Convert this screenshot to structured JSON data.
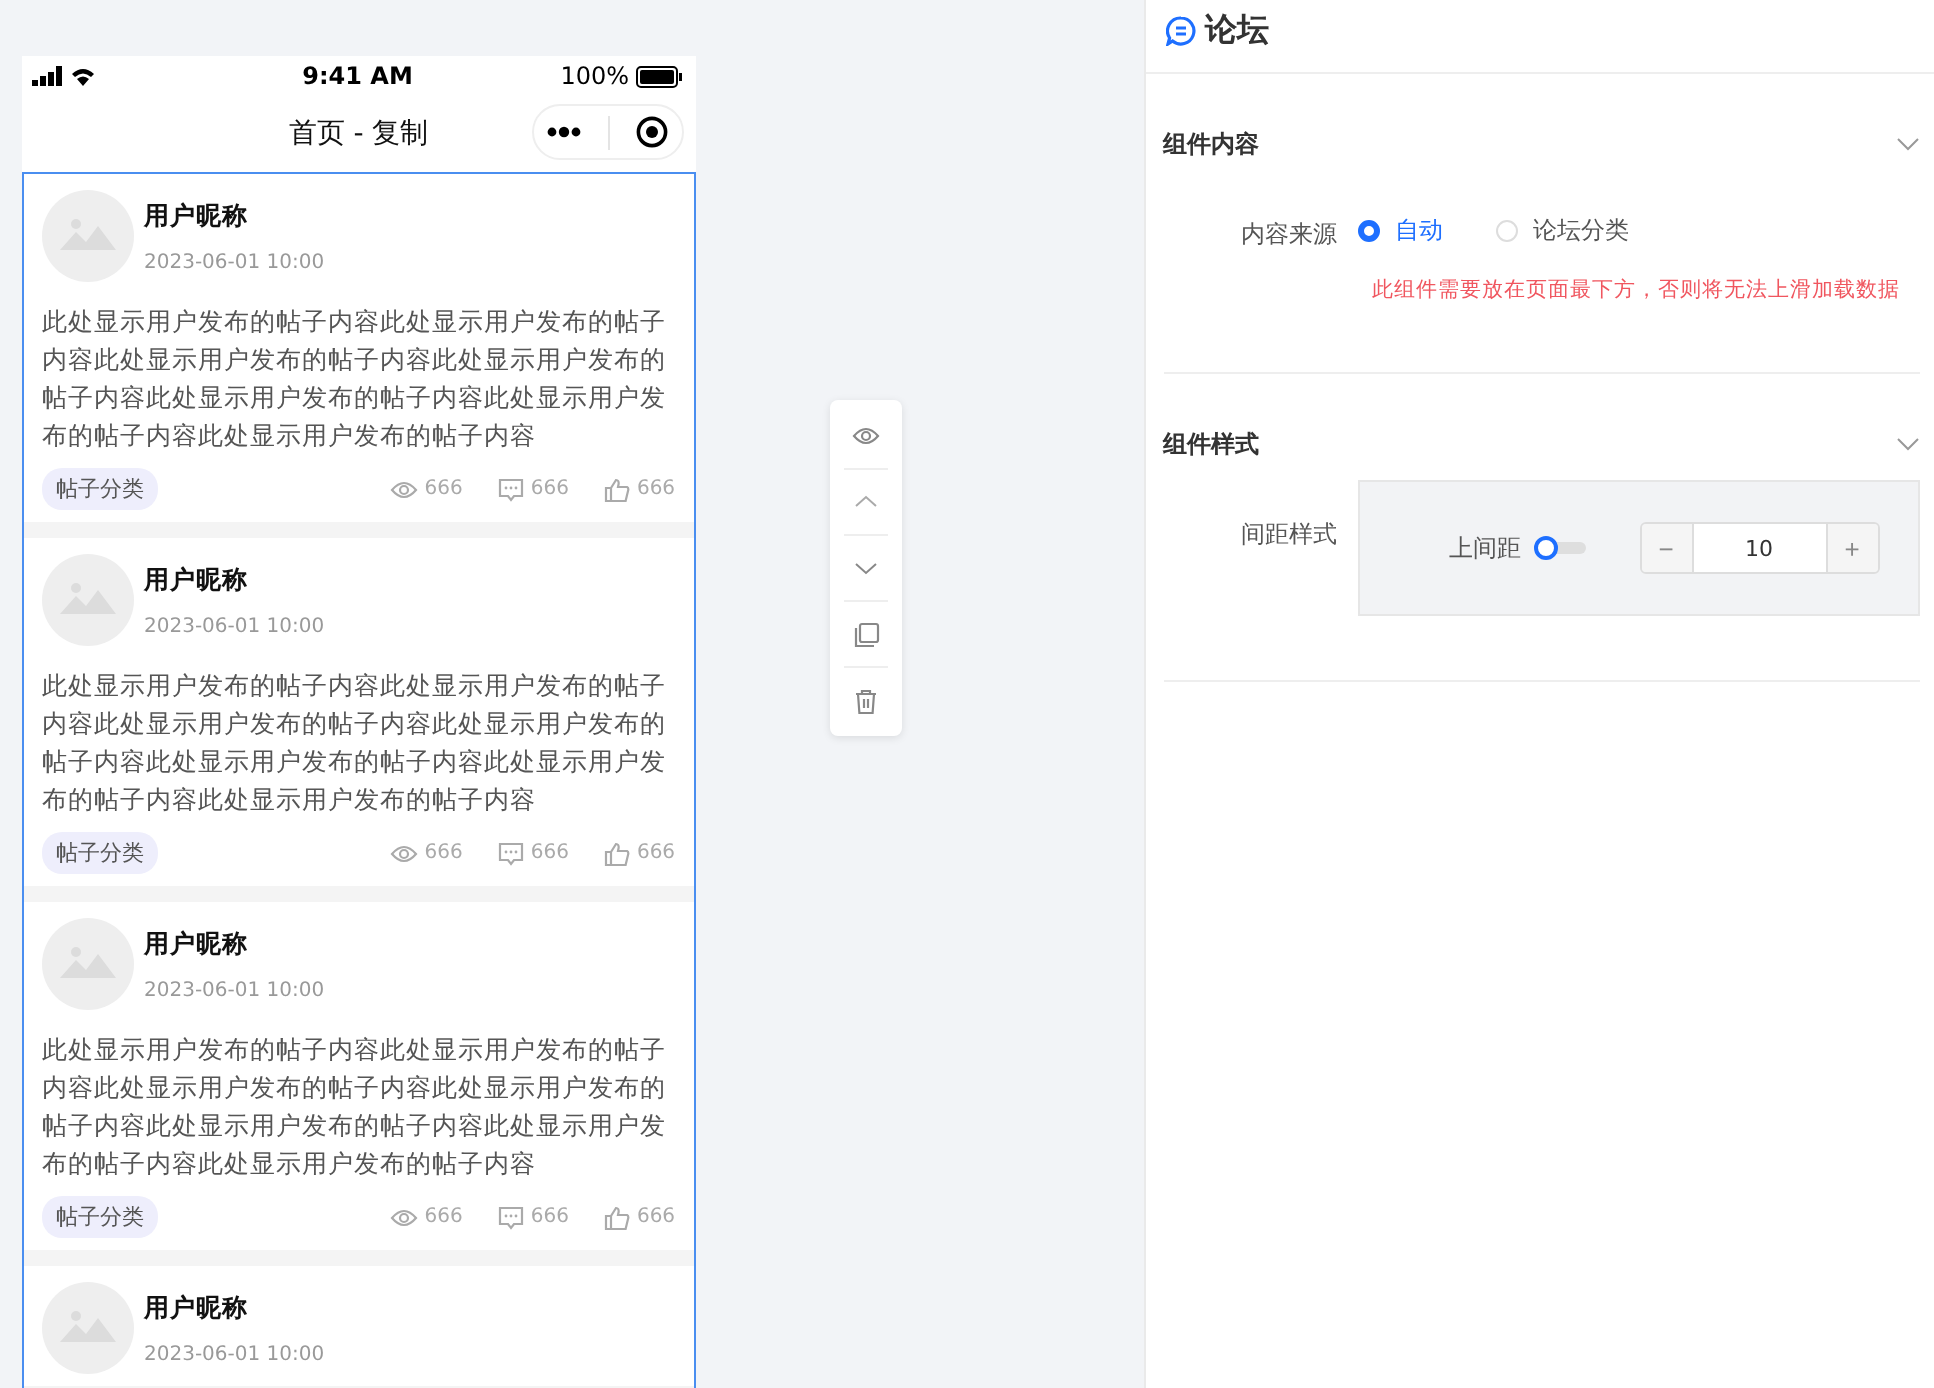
{
  "phone": {
    "status_bar": {
      "time": "9:41 AM",
      "battery": "100%"
    },
    "nav_title": "首页 - 复制",
    "posts": [
      {
        "name": "用户昵称",
        "time": "2023-06-01 10:00",
        "body": "此处显示用户发布的帖子内容此处显示用户发布的帖子内容此处显示用户发布的帖子内容此处显示用户发布的帖子内容此处显示用户发布的帖子内容此处显示用户发布的帖子内容此处显示用户发布的帖子内容",
        "tag": "帖子分类",
        "views": "666",
        "comments": "666",
        "likes": "666"
      },
      {
        "name": "用户昵称",
        "time": "2023-06-01 10:00",
        "body": "此处显示用户发布的帖子内容此处显示用户发布的帖子内容此处显示用户发布的帖子内容此处显示用户发布的帖子内容此处显示用户发布的帖子内容此处显示用户发布的帖子内容此处显示用户发布的帖子内容",
        "tag": "帖子分类",
        "views": "666",
        "comments": "666",
        "likes": "666"
      },
      {
        "name": "用户昵称",
        "time": "2023-06-01 10:00",
        "body": "此处显示用户发布的帖子内容此处显示用户发布的帖子内容此处显示用户发布的帖子内容此处显示用户发布的帖子内容此处显示用户发布的帖子内容此处显示用户发布的帖子内容此处显示用户发布的帖子内容",
        "tag": "帖子分类",
        "views": "666",
        "comments": "666",
        "likes": "666"
      },
      {
        "name": "用户昵称",
        "time": "2023-06-01 10:00"
      }
    ]
  },
  "panel": {
    "title": "论坛",
    "sections": [
      {
        "title": "组件内容",
        "kind": "content",
        "label": "内容来源",
        "options": [
          {
            "label": "自动",
            "selected": true
          },
          {
            "label": "论坛分类",
            "selected": false
          }
        ],
        "warning": "此组件需要放在页面最下方，否则将无法上滑加载数据"
      },
      {
        "title": "组件样式",
        "kind": "style",
        "label": "间距样式",
        "switch_label": "上间距",
        "on": false,
        "value": "10",
        "minus": "−",
        "plus": "+"
      }
    ]
  }
}
